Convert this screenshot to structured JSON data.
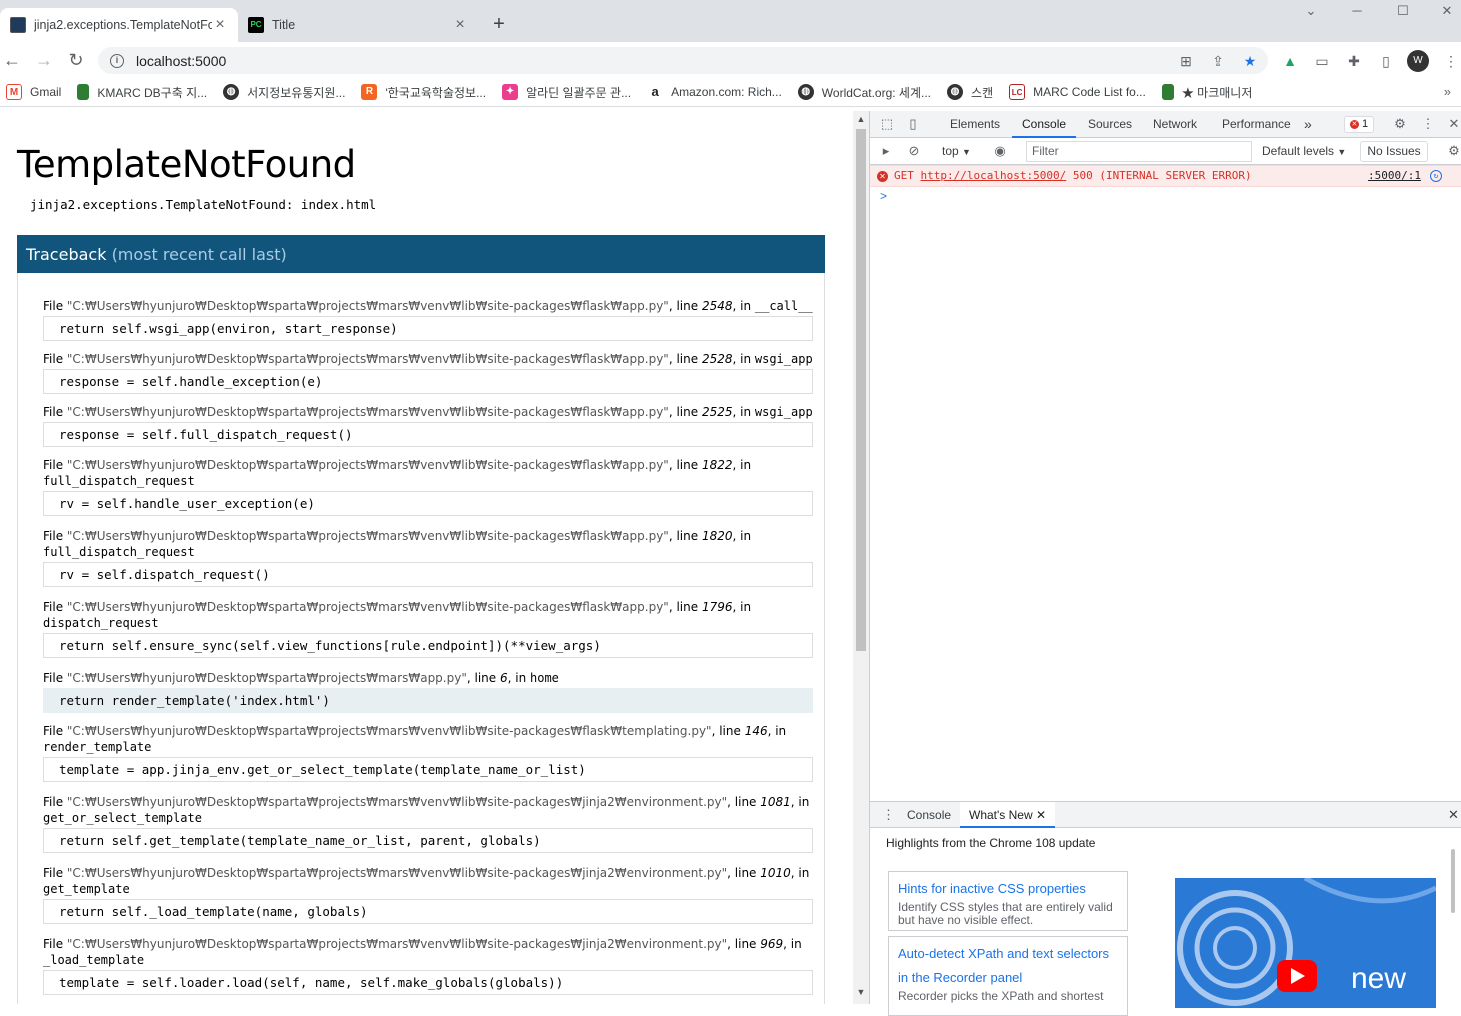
{
  "browser": {
    "tabs": [
      {
        "title": "jinja2.exceptions.TemplateNotFo",
        "active": true
      },
      {
        "title": "Title",
        "active": false
      }
    ],
    "window_controls": [
      "⌄",
      "─",
      "☐",
      "✕"
    ],
    "address": "localhost:5000",
    "bookmarks": [
      {
        "label": "Gmail",
        "icon": "gmail-icon",
        "color": "#ea4335"
      },
      {
        "label": "KMARC DB구축 지...",
        "icon": "bookmark-green-icon",
        "color": "#2e7d32"
      },
      {
        "label": "서지정보유통지원...",
        "icon": "globe-icon",
        "color": "#333333"
      },
      {
        "label": "'한국교육학술정보...",
        "icon": "riss-icon",
        "color": "#f26522"
      },
      {
        "label": "알라딘 일괄주문 관...",
        "icon": "aladin-icon",
        "color": "#ec3e8e"
      },
      {
        "label": "Amazon.com: Rich...",
        "icon": "amazon-icon",
        "color": "#222222"
      },
      {
        "label": "WorldCat.org: 세계...",
        "icon": "globe-icon",
        "color": "#333333"
      },
      {
        "label": "스캔",
        "icon": "globe-icon",
        "color": "#333333"
      },
      {
        "label": "MARC Code List fo...",
        "icon": "loc-icon",
        "color": "#b22222"
      },
      {
        "label": "★ 마크매니저",
        "icon": "bookmark-green-icon",
        "color": "#2e7d32"
      }
    ]
  },
  "error_page": {
    "title": "TemplateNotFound",
    "exception": "jinja2.exceptions.TemplateNotFound: index.html",
    "traceback_title": "Traceback",
    "traceback_sub": "(most recent call last)",
    "frames": [
      {
        "path": "\"C:₩Users₩hyunjuro₩Desktop₩sparta₩projects₩mars₩venv₩lib₩site-packages₩flask₩app.py\"",
        "line": "2548",
        "func": "__call__",
        "code": "return self.wsgi_app(environ, start_response)",
        "current": false,
        "wrap": false
      },
      {
        "path": "\"C:₩Users₩hyunjuro₩Desktop₩sparta₩projects₩mars₩venv₩lib₩site-packages₩flask₩app.py\"",
        "line": "2528",
        "func": "wsgi_app",
        "code": "response = self.handle_exception(e)",
        "current": false,
        "wrap": false
      },
      {
        "path": "\"C:₩Users₩hyunjuro₩Desktop₩sparta₩projects₩mars₩venv₩lib₩site-packages₩flask₩app.py\"",
        "line": "2525",
        "func": "wsgi_app",
        "code": "response = self.full_dispatch_request()",
        "current": false,
        "wrap": false
      },
      {
        "path": "\"C:₩Users₩hyunjuro₩Desktop₩sparta₩projects₩mars₩venv₩lib₩site-packages₩flask₩app.py\"",
        "line": "1822",
        "func": "full_dispatch_request",
        "code": "rv = self.handle_user_exception(e)",
        "current": false,
        "wrap": true
      },
      {
        "path": "\"C:₩Users₩hyunjuro₩Desktop₩sparta₩projects₩mars₩venv₩lib₩site-packages₩flask₩app.py\"",
        "line": "1820",
        "func": "full_dispatch_request",
        "code": "rv = self.dispatch_request()",
        "current": false,
        "wrap": true
      },
      {
        "path": "\"C:₩Users₩hyunjuro₩Desktop₩sparta₩projects₩mars₩venv₩lib₩site-packages₩flask₩app.py\"",
        "line": "1796",
        "func": "dispatch_request",
        "code": "return self.ensure_sync(self.view_functions[rule.endpoint])(**view_args)",
        "current": false,
        "wrap": true
      },
      {
        "path": "\"C:₩Users₩hyunjuro₩Desktop₩sparta₩projects₩mars₩app.py\"",
        "line": "6",
        "func": "home",
        "code": "return render_template('index.html')",
        "current": true,
        "wrap": false
      },
      {
        "path": "\"C:₩Users₩hyunjuro₩Desktop₩sparta₩projects₩mars₩venv₩lib₩site-packages₩flask₩templating.py\"",
        "line": "146",
        "func": "render_template",
        "code": "template = app.jinja_env.get_or_select_template(template_name_or_list)",
        "current": false,
        "wrap": true
      },
      {
        "path": "\"C:₩Users₩hyunjuro₩Desktop₩sparta₩projects₩mars₩venv₩lib₩site-packages₩jinja2₩environment.py\"",
        "line": "1081",
        "func": "get_or_select_template",
        "code": "return self.get_template(template_name_or_list, parent, globals)",
        "current": false,
        "wrap": true
      },
      {
        "path": "\"C:₩Users₩hyunjuro₩Desktop₩sparta₩projects₩mars₩venv₩lib₩site-packages₩jinja2₩environment.py\"",
        "line": "1010",
        "func": "get_template",
        "code": "return self._load_template(name, globals)",
        "current": false,
        "wrap": true
      },
      {
        "path": "\"C:₩Users₩hyunjuro₩Desktop₩sparta₩projects₩mars₩venv₩lib₩site-packages₩jinja2₩environment.py\"",
        "line": "969",
        "func": "_load_template",
        "code": "template = self.loader.load(self, name, self.make_globals(globals))",
        "current": false,
        "wrap": true
      }
    ]
  },
  "devtools": {
    "tabs": [
      "Elements",
      "Console",
      "Sources",
      "Network",
      "Performance"
    ],
    "active_tab": "Console",
    "more": "»",
    "error_count": "1",
    "context": "top",
    "filter_placeholder": "Filter",
    "levels": "Default levels",
    "issues": "No Issues",
    "error": {
      "method": "GET",
      "url": "http://localhost:5000/",
      "status": "500 (INTERNAL SERVER ERROR)",
      "source": ":5000/:1"
    },
    "prompt": ">",
    "drawer": {
      "tabs": [
        "Console",
        "What's New"
      ],
      "active_tab": "What's New",
      "heading": "Highlights from the Chrome 108 update",
      "cards": [
        {
          "title": "Hints for inactive CSS properties",
          "desc": "Identify CSS styles that are entirely valid but have no visible effect."
        },
        {
          "title": "Auto-detect XPath and text selectors in the Recorder panel",
          "desc": "Recorder picks the XPath and shortest"
        }
      ],
      "image_text": "new"
    }
  }
}
